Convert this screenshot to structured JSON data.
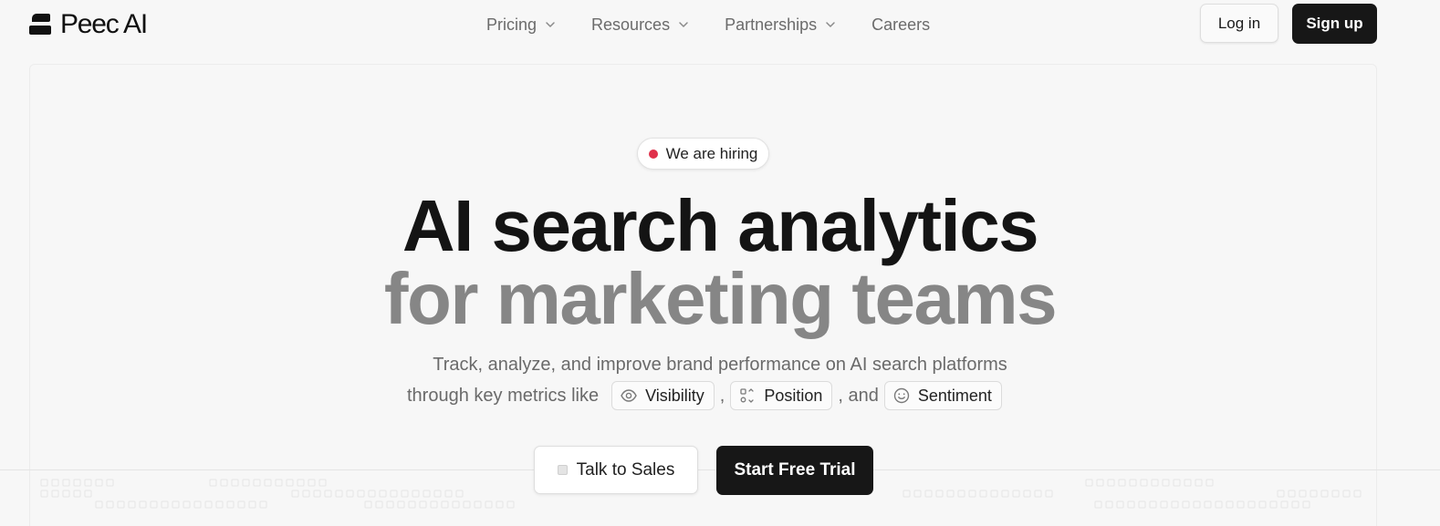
{
  "header": {
    "logo_text": "Peec AI",
    "nav": [
      {
        "label": "Pricing",
        "has_dropdown": true
      },
      {
        "label": "Resources",
        "has_dropdown": true
      },
      {
        "label": "Partnerships",
        "has_dropdown": true
      },
      {
        "label": "Careers",
        "has_dropdown": false
      }
    ],
    "login_label": "Log in",
    "signup_label": "Sign up"
  },
  "hero": {
    "badge_label": "We are hiring",
    "badge_dot_color": "#e0314b",
    "title_line1": "AI search analytics",
    "title_line2": "for marketing teams",
    "subtitle_line1": "Track, analyze, and improve brand performance on AI search platforms",
    "subtitle_line2_prefix": "through key metrics like",
    "metrics": [
      {
        "label": "Visibility",
        "icon": "eye-icon"
      },
      {
        "label": "Position",
        "icon": "position-icon"
      },
      {
        "label": "Sentiment",
        "icon": "smiley-icon"
      }
    ],
    "sep_comma": ",",
    "sep_and": ", and",
    "talk_to_sales_label": "Talk to Sales",
    "start_trial_label": "Start Free Trial"
  },
  "colors": {
    "primary_button": "#171717",
    "title_dark": "#141414",
    "title_muted": "#868686",
    "background": "#f7f7f7"
  }
}
